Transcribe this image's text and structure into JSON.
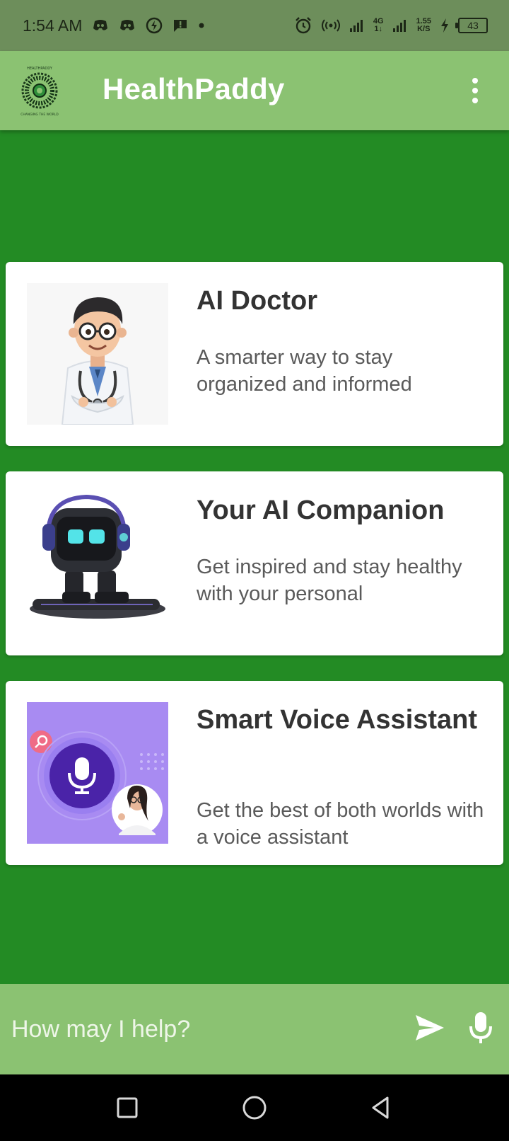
{
  "status_bar": {
    "time": "1:54 AM",
    "network_type": "4G",
    "net_sub": "1↓",
    "speed_value": "1.55",
    "speed_unit": "K/S",
    "battery": "43"
  },
  "app_bar": {
    "title": "HealthPaddy",
    "logo_text_top": "HEALTHPADDY",
    "logo_text_bottom": "CHANGING THE WORLD"
  },
  "cards": [
    {
      "title": "AI Doctor",
      "description": "A smarter way to stay organized and informed",
      "image": "doctor-avatar"
    },
    {
      "title": "Your AI Companion",
      "description": "Get inspired and stay healthy with your personal",
      "image": "robot-companion"
    },
    {
      "title": "Smart Voice Assistant",
      "description": "Get the best of both worlds with a voice assistant",
      "image": "voice-assistant"
    }
  ],
  "input": {
    "placeholder": "How may I help?",
    "value": ""
  },
  "icons": {
    "menu": "more-vert-icon",
    "send": "send-icon",
    "mic": "mic-icon",
    "nav_recent": "square-icon",
    "nav_home": "circle-icon",
    "nav_back": "triangle-back-icon"
  },
  "colors": {
    "background": "#238b24",
    "app_bar": "#8bc272",
    "status_bar": "#6d8e5b",
    "card": "#ffffff",
    "voice_card_bg": "#a88bf2"
  }
}
